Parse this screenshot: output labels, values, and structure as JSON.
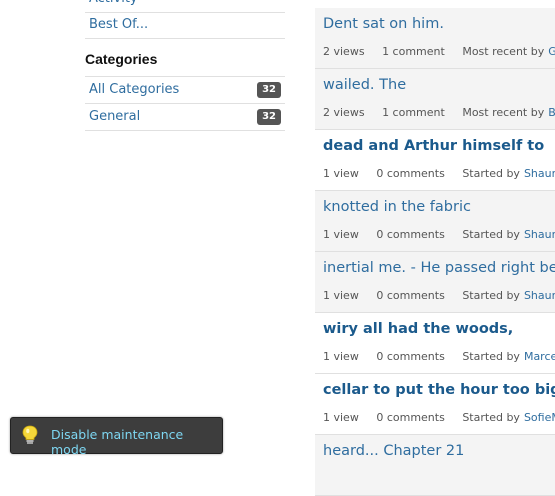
{
  "sidebar": {
    "links": [
      "Activity",
      "Best Of..."
    ],
    "categories_heading": "Categories",
    "categories": [
      {
        "label": "All Categories",
        "count": "32"
      },
      {
        "label": "General",
        "count": "32"
      }
    ]
  },
  "discussions": [
    {
      "title": "Dent sat on him.",
      "views": "2 views",
      "comments": "1 comment",
      "recent_label": "Most recent by",
      "user": "Gr",
      "read": true
    },
    {
      "title": "wailed. The",
      "views": "2 views",
      "comments": "1 comment",
      "recent_label": "Most recent by",
      "user": "Ba",
      "read": true
    },
    {
      "title": "dead and Arthur himself to",
      "views": "1 view",
      "comments": "0 comments",
      "recent_label": "Started by",
      "user": "Shauna",
      "read": false
    },
    {
      "title": "knotted in the fabric",
      "views": "1 view",
      "comments": "0 comments",
      "recent_label": "Started by",
      "user": "Shauna",
      "read": true
    },
    {
      "title": "inertial me. - He passed right betw",
      "views": "1 view",
      "comments": "0 comments",
      "recent_label": "Started by",
      "user": "Shauna",
      "read": true
    },
    {
      "title": "wiry all had the woods,",
      "views": "1 view",
      "comments": "0 comments",
      "recent_label": "Started by",
      "user": "Marcel",
      "read": false
    },
    {
      "title": "cellar to put the hour too big.",
      "views": "1 view",
      "comments": "0 comments",
      "recent_label": "Started by",
      "user": "SofieM",
      "read": false
    },
    {
      "title": "heard... Chapter 21",
      "views": "",
      "comments": "",
      "recent_label": "",
      "user": "",
      "read": true
    }
  ],
  "maintenance": {
    "label": "Disable maintenance mode",
    "icon": "lightbulb-icon"
  },
  "colors": {
    "link": "#2f6d9f",
    "read_row_bg": "#f4f4f4",
    "maintenance_bg": "#3d3d3d",
    "maintenance_text": "#7ed7f2",
    "badge_bg": "#555555"
  }
}
